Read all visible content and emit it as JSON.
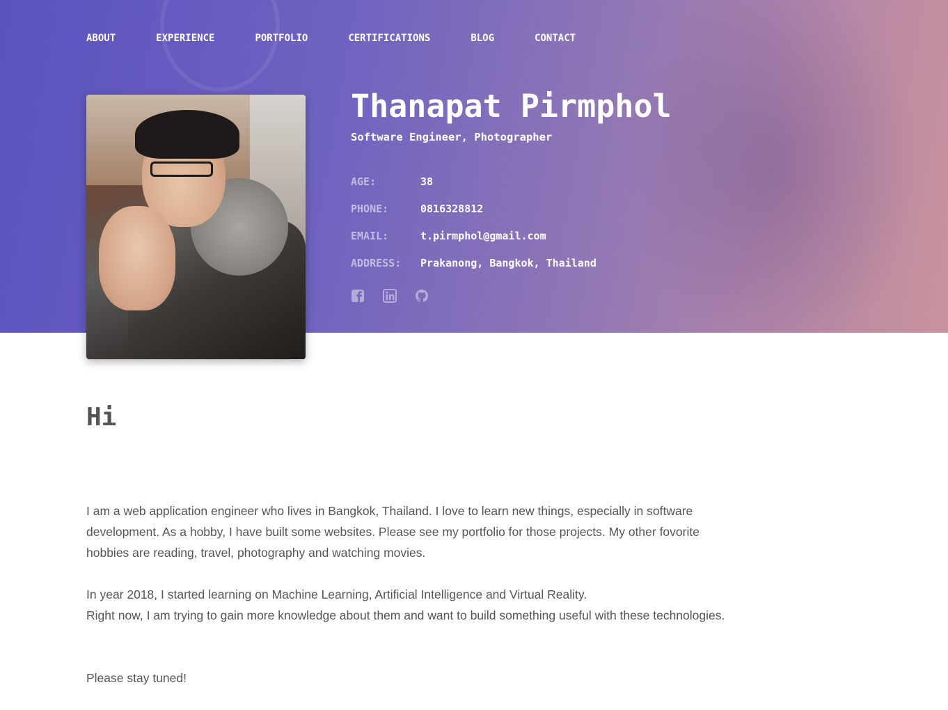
{
  "nav": {
    "items": [
      {
        "label": "ABOUT"
      },
      {
        "label": "EXPERIENCE"
      },
      {
        "label": "PORTFOLIO"
      },
      {
        "label": "CERTIFICATIONS"
      },
      {
        "label": "BLOG"
      },
      {
        "label": "CONTACT"
      }
    ]
  },
  "profile": {
    "name": "Thanapat Pirmphol",
    "subtitle": "Software Engineer, Photographer",
    "info": [
      {
        "label": "AGE:",
        "value": "38"
      },
      {
        "label": "PHONE:",
        "value": "0816328812"
      },
      {
        "label": "EMAIL:",
        "value": "t.pirmphol@gmail.com"
      },
      {
        "label": "ADDRESS:",
        "value": "Prakanong, Bangkok, Thailand"
      }
    ],
    "social": [
      "facebook-icon",
      "linkedin-icon",
      "github-icon"
    ]
  },
  "about": {
    "heading": "Hi",
    "paragraph1": "I am a web application engineer who lives in Bangkok, Thailand. I love to learn new things, especially in software development. As a hobby, I have built some websites. Please see my portfolio for those projects. My other fovorite hobbies are reading, travel, photography and watching movies.",
    "paragraph2_line1": "In year 2018, I started learning on Machine Learning, Artificial Intelligence and Virtual Reality.",
    "paragraph2_line2": "Right now, I am trying to gain more knowledge about them and want to build something useful with these technologies.",
    "paragraph3": "Please stay tuned!"
  },
  "colors": {
    "hero_start": "#5a52bf",
    "hero_end": "#c8939c",
    "body_text": "#555555"
  }
}
